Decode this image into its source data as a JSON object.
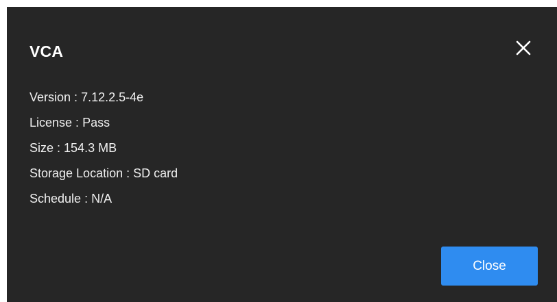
{
  "dialog": {
    "title": "VCA",
    "close_icon": "close-icon",
    "details": [
      {
        "label": "Version",
        "separator": " : ",
        "value": "7.12.2.5-4e",
        "text": "Version : 7.12.2.5-4e"
      },
      {
        "label": "License",
        "separator": " : ",
        "value": "Pass",
        "text": "License : Pass"
      },
      {
        "label": "Size",
        "separator": " : ",
        "value": "154.3 MB",
        "text": "Size : 154.3 MB"
      },
      {
        "label": "Storage Location",
        "separator": " : ",
        "value": "SD card",
        "text": "Storage Location : SD card"
      },
      {
        "label": "Schedule",
        "separator": " : ",
        "value": "N/A",
        "text": "Schedule : N/A"
      }
    ],
    "close_button_label": "Close"
  },
  "colors": {
    "dialog_background": "#262626",
    "text": "#f2f2f2",
    "accent": "#2f8cf0"
  }
}
